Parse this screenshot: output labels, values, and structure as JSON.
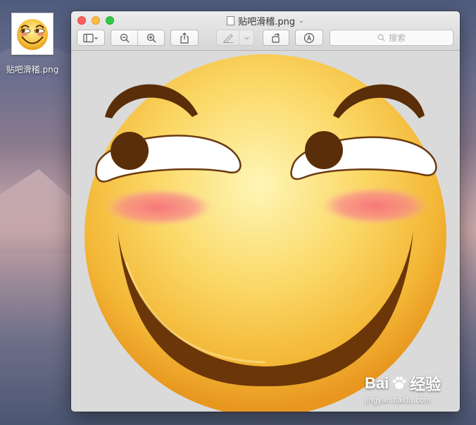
{
  "desktop": {
    "icon_label": "贴吧滑稽.png"
  },
  "window": {
    "title": "贴吧滑稽.png",
    "title_chevron": "⌄"
  },
  "toolbar": {
    "search_placeholder": "搜索"
  },
  "watermark": {
    "brand_left": "Bai",
    "brand_right": "经验",
    "url": "jingyan.baidu.com"
  },
  "colors": {
    "close": "#fc605c",
    "minimize": "#fdbc40",
    "zoom": "#34c84a",
    "face": "#f5c33b",
    "face_highlight": "#fdf0a0",
    "brown": "#5a2e08",
    "blush": "#f7787e"
  },
  "icons": {
    "sidebar": "sidebar-icon",
    "zoom_out": "zoom-out-icon",
    "zoom_in": "zoom-in-icon",
    "share": "share-icon",
    "pen": "pen-icon",
    "rotate": "rotate-icon",
    "markup": "markup-icon",
    "search": "search-icon"
  }
}
